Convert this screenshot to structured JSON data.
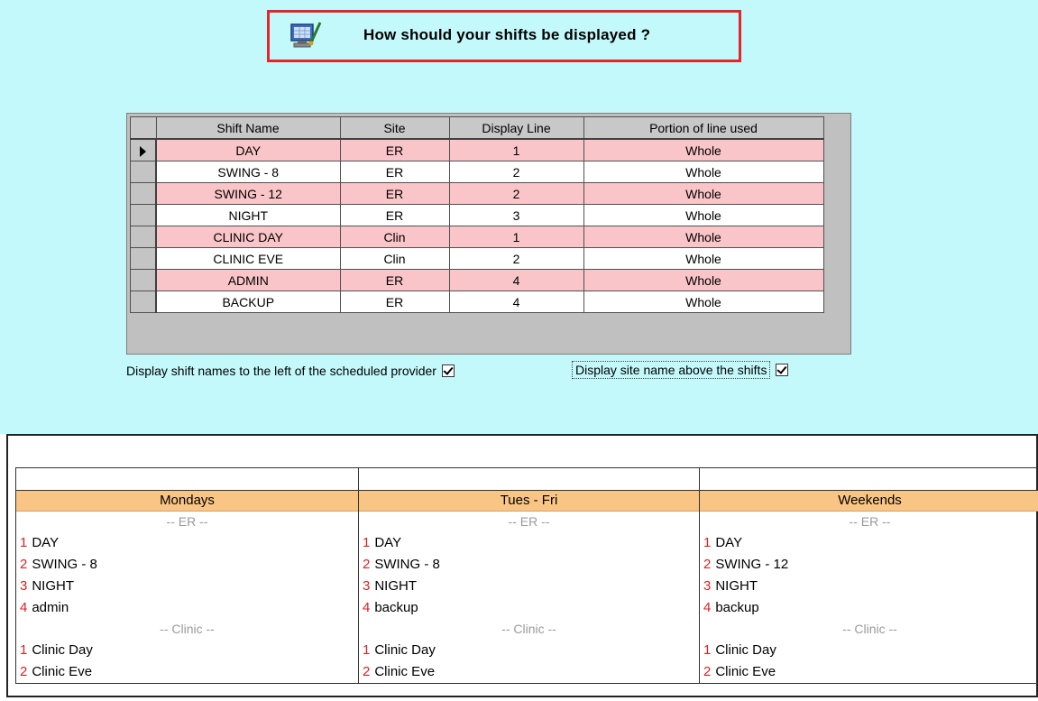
{
  "header": {
    "title": "How should your shifts be displayed ?",
    "icon": "monitor-paint-icon",
    "border_color": "#e2262b"
  },
  "grid": {
    "columns": [
      "Shift Name",
      "Site",
      "Display Line",
      "Portion of line used"
    ],
    "rows": [
      {
        "shift": "DAY",
        "site": "ER",
        "line": "1",
        "portion": "Whole",
        "color": "pink",
        "selected": true
      },
      {
        "shift": "SWING - 8",
        "site": "ER",
        "line": "2",
        "portion": "Whole",
        "color": "white"
      },
      {
        "shift": "SWING - 12",
        "site": "ER",
        "line": "2",
        "portion": "Whole",
        "color": "pink"
      },
      {
        "shift": "NIGHT",
        "site": "ER",
        "line": "3",
        "portion": "Whole",
        "color": "white"
      },
      {
        "shift": "CLINIC DAY",
        "site": "Clin",
        "line": "1",
        "portion": "Whole",
        "color": "pink"
      },
      {
        "shift": "CLINIC EVE",
        "site": "Clin",
        "line": "2",
        "portion": "Whole",
        "color": "white"
      },
      {
        "shift": "ADMIN",
        "site": "ER",
        "line": "4",
        "portion": "Whole",
        "color": "pink"
      },
      {
        "shift": "BACKUP",
        "site": "ER",
        "line": "4",
        "portion": "Whole",
        "color": "white"
      }
    ]
  },
  "options": {
    "shift_names_left": {
      "label": "Display shift names to the left of the scheduled provider",
      "checked": true
    },
    "site_name_above": {
      "label": "Display site name above the shifts",
      "checked": true
    }
  },
  "preview": {
    "columns": [
      {
        "day": "Mondays",
        "groups": [
          {
            "site": "-- ER --",
            "lines": [
              {
                "num": "1",
                "text": "DAY"
              },
              {
                "num": "2",
                "text": "SWING - 8"
              },
              {
                "num": "3",
                "text": "NIGHT"
              },
              {
                "num": "4",
                "text": "admin"
              }
            ]
          },
          {
            "site": "-- Clinic --",
            "lines": [
              {
                "num": "1",
                "text": "Clinic Day"
              },
              {
                "num": "2",
                "text": "Clinic Eve"
              }
            ]
          }
        ]
      },
      {
        "day": "Tues - Fri",
        "groups": [
          {
            "site": "-- ER --",
            "lines": [
              {
                "num": "1",
                "text": "DAY"
              },
              {
                "num": "2",
                "text": "SWING - 8"
              },
              {
                "num": "3",
                "text": "NIGHT"
              },
              {
                "num": "4",
                "text": "backup"
              }
            ]
          },
          {
            "site": "-- Clinic --",
            "lines": [
              {
                "num": "1",
                "text": "Clinic Day"
              },
              {
                "num": "2",
                "text": "Clinic Eve"
              }
            ]
          }
        ]
      },
      {
        "day": "Weekends",
        "groups": [
          {
            "site": "-- ER --",
            "lines": [
              {
                "num": "1",
                "text": "DAY"
              },
              {
                "num": "2",
                "text": "SWING - 12"
              },
              {
                "num": "3",
                "text": "NIGHT"
              },
              {
                "num": "4",
                "text": "backup"
              }
            ]
          },
          {
            "site": "-- Clinic --",
            "lines": [
              {
                "num": "1",
                "text": "Clinic Day"
              },
              {
                "num": "2",
                "text": "Clinic Eve"
              }
            ]
          }
        ]
      }
    ],
    "day_band_color": "#f9c584",
    "line_number_color": "#e0201f"
  }
}
